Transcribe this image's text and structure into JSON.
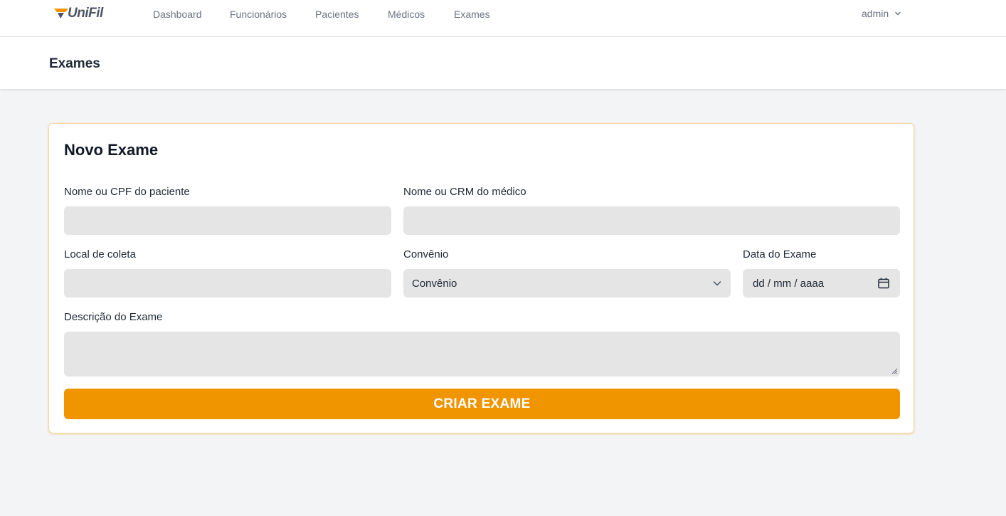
{
  "app": {
    "logo_text": "UniFil",
    "brand_color": "#f09400"
  },
  "nav": {
    "items": [
      {
        "label": "Dashboard"
      },
      {
        "label": "Funcionários"
      },
      {
        "label": "Pacientes"
      },
      {
        "label": "Médicos"
      },
      {
        "label": "Exames"
      }
    ],
    "user": {
      "label": "admin",
      "icon": "chevron-down-icon"
    }
  },
  "header": {
    "title": "Exames"
  },
  "form": {
    "title": "Novo Exame",
    "patient": {
      "label": "Nome ou CPF do paciente",
      "value": ""
    },
    "doctor": {
      "label": "Nome ou CRM do médico",
      "value": ""
    },
    "location": {
      "label": "Local de coleta",
      "value": ""
    },
    "insurance": {
      "label": "Convênio",
      "selected": "Convênio",
      "icon": "chevron-down-icon"
    },
    "date": {
      "label": "Data do Exame",
      "placeholder": "dd / mm / aaaa",
      "icon": "calendar-icon"
    },
    "description": {
      "label": "Descrição do Exame",
      "value": ""
    },
    "submit_label": "CRIAR EXAME"
  }
}
